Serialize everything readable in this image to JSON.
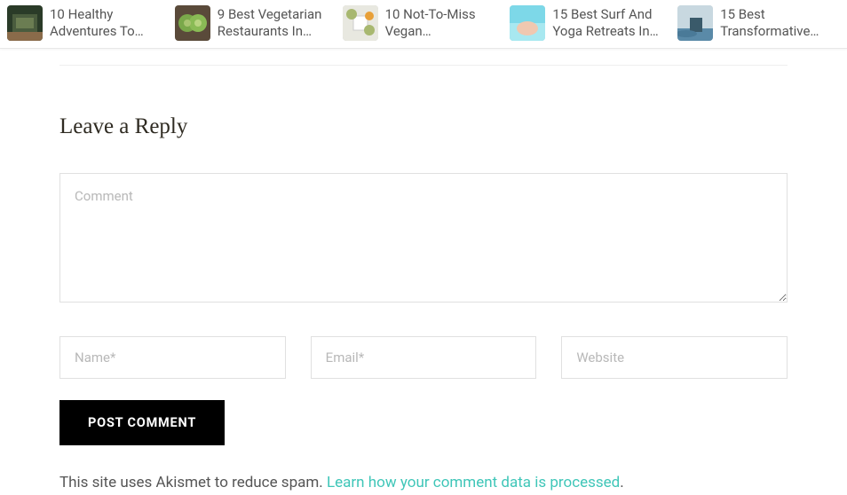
{
  "topbar": {
    "items": [
      {
        "title": "10 Healthy Adventures To…"
      },
      {
        "title": "9 Best Vegetarian Restaurants In…"
      },
      {
        "title": "10 Not-To-Miss Vegan…"
      },
      {
        "title": "15 Best Surf And Yoga Retreats In…"
      },
      {
        "title": "15 Best Transformative…"
      }
    ]
  },
  "reply": {
    "heading": "Leave a Reply",
    "comment_placeholder": "Comment",
    "name_placeholder": "Name*",
    "email_placeholder": "Email*",
    "website_placeholder": "Website",
    "submit_label": "POST COMMENT"
  },
  "akismet": {
    "text_prefix": "This site uses Akismet to reduce spam. ",
    "link_text": "Learn how your comment data is processed",
    "text_suffix": "."
  }
}
